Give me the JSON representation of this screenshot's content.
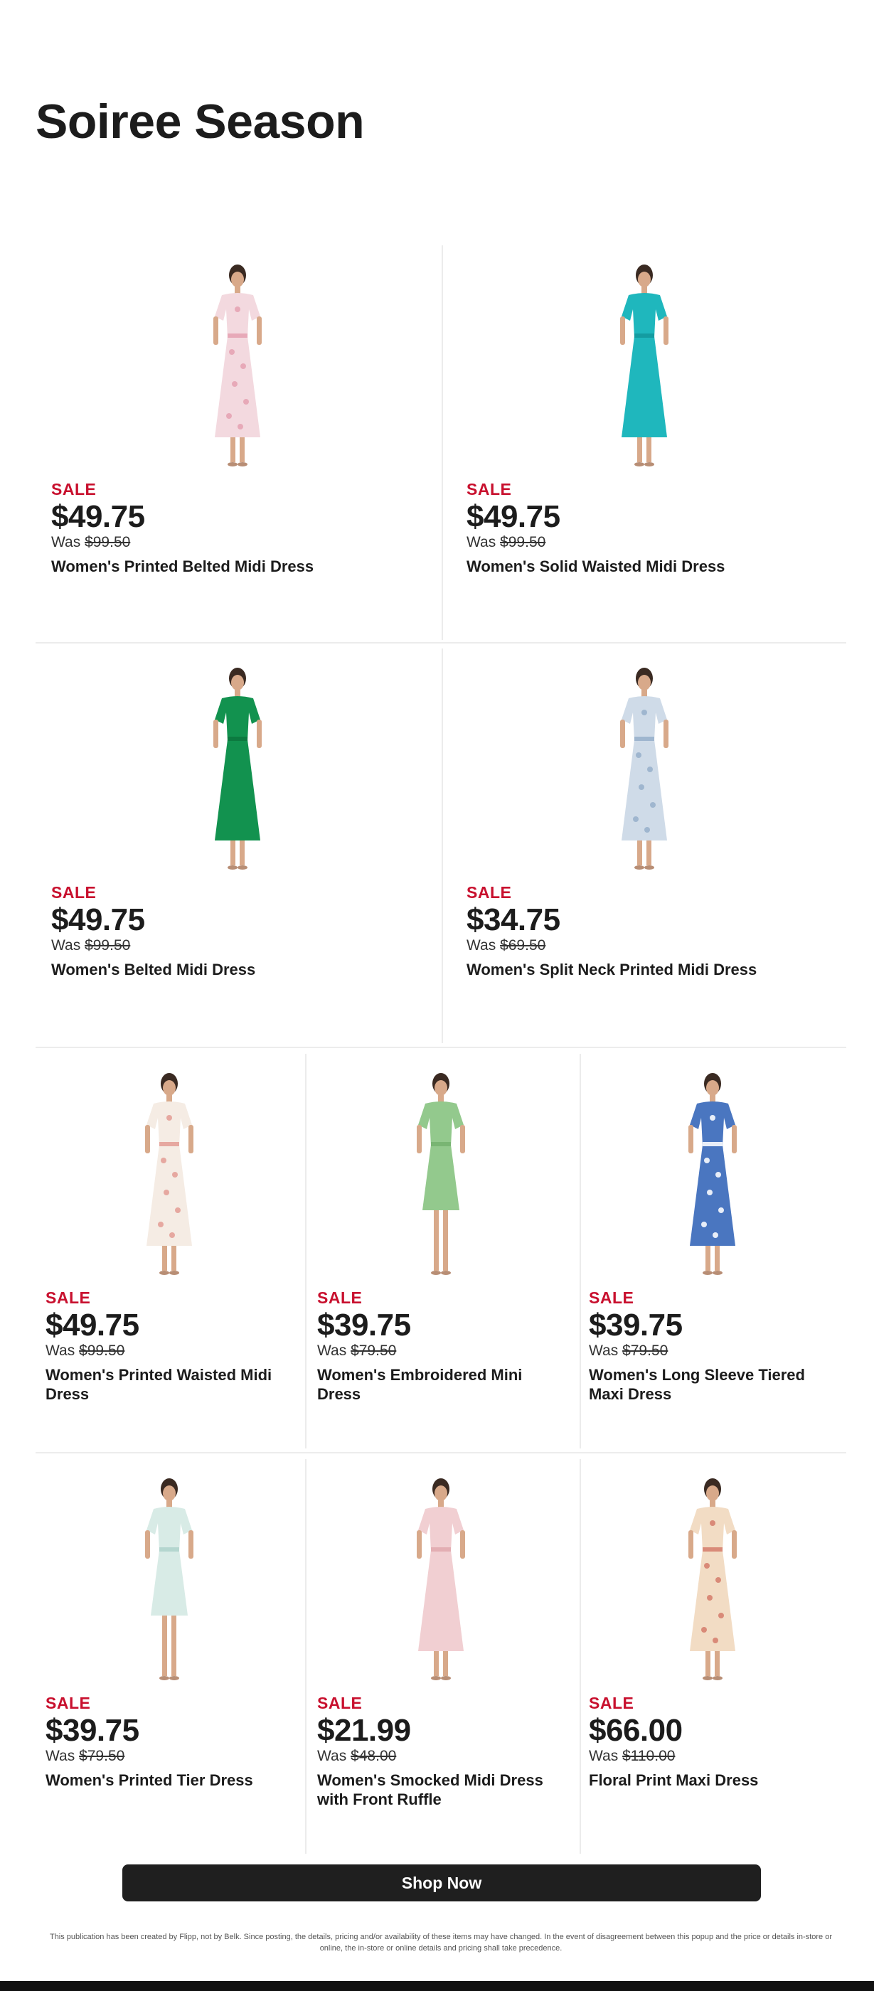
{
  "page": {
    "title": "Soiree Season"
  },
  "products": [
    {
      "sale": "SALE",
      "price": "$49.75",
      "was_label": "Was",
      "was_price": "$99.50",
      "name": "Women's Printed Belted Midi Dress",
      "dress_color": "#f3d9df",
      "accent": "#e7a9b8"
    },
    {
      "sale": "SALE",
      "price": "$49.75",
      "was_label": "Was",
      "was_price": "$99.50",
      "name": "Women's Solid Waisted Midi Dress",
      "dress_color": "#1fb7bd",
      "accent": "#149ca1"
    },
    {
      "sale": "SALE",
      "price": "$49.75",
      "was_label": "Was",
      "was_price": "$99.50",
      "name": "Women's Belted Midi Dress",
      "dress_color": "#12924f",
      "accent": "#0c7a40"
    },
    {
      "sale": "SALE",
      "price": "$34.75",
      "was_label": "Was",
      "was_price": "$69.50",
      "name": "Women's Split Neck Printed Midi Dress",
      "dress_color": "#cfdbe8",
      "accent": "#9fb6cf"
    },
    {
      "sale": "SALE",
      "price": "$49.75",
      "was_label": "Was",
      "was_price": "$99.50",
      "name": "Women's Printed Waisted Midi Dress",
      "dress_color": "#f5ece4",
      "accent": "#e6a8a0"
    },
    {
      "sale": "SALE",
      "price": "$39.75",
      "was_label": "Was",
      "was_price": "$79.50",
      "name": "Women's Embroidered Mini Dress",
      "dress_color": "#93c98d",
      "accent": "#79b573"
    },
    {
      "sale": "SALE",
      "price": "$39.75",
      "was_label": "Was",
      "was_price": "$79.50",
      "name": "Women's Long Sleeve Tiered Maxi Dress",
      "dress_color": "#4a76c0",
      "accent": "#e8eef8"
    },
    {
      "sale": "SALE",
      "price": "$39.75",
      "was_label": "Was",
      "was_price": "$79.50",
      "name": "Women's Printed Tier Dress",
      "dress_color": "#d8ebe6",
      "accent": "#b4d6cf"
    },
    {
      "sale": "SALE",
      "price": "$21.99",
      "was_label": "Was",
      "was_price": "$48.00",
      "name": "Women's Smocked Midi Dress with Front Ruffle",
      "dress_color": "#f1cfd2",
      "accent": "#e3aeb3"
    },
    {
      "sale": "SALE",
      "price": "$66.00",
      "was_label": "Was",
      "was_price": "$110.00",
      "name": "Floral Print Maxi Dress",
      "dress_color": "#f2dcc4",
      "accent": "#d98a78"
    }
  ],
  "cta": {
    "label": "Shop Now"
  },
  "disclaimer": "This publication has been created by Flipp, not by Belk. Since posting, the details, pricing and/or availability of these items may have changed. In the event of disagreement between this popup and the price or details in-store or online, the in-store or online details and pricing shall take precedence."
}
